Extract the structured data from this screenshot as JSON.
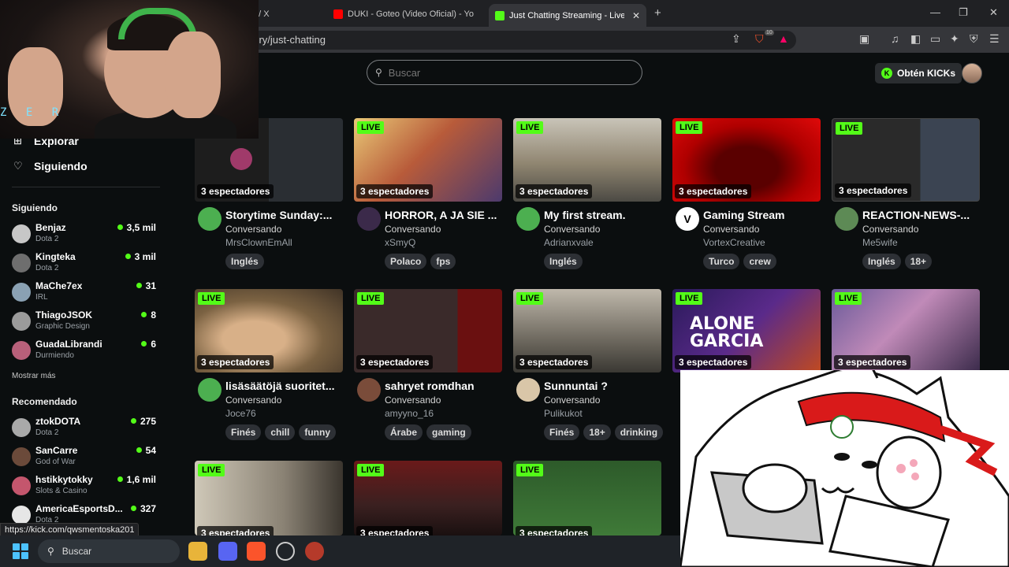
{
  "browser": {
    "tabs": [
      {
        "label": "OG / X"
      },
      {
        "label": "DUKI - Goteo (Video Oficial) - Yo"
      },
      {
        "label": "Just Chatting Streaming - Live St"
      }
    ],
    "url": "gory/just-chatting",
    "brave_badge": "10"
  },
  "header": {
    "search_placeholder": "Buscar",
    "kicks_label": "Obtén KICKs"
  },
  "sidebar": {
    "nav": [
      {
        "label": "Explorar"
      },
      {
        "label": "Siguiendo"
      }
    ],
    "following_title": "Siguiendo",
    "following": [
      {
        "name": "Benjaz",
        "category": "Dota 2",
        "viewers": "3,5 mil"
      },
      {
        "name": "Kingteka",
        "category": "Dota 2",
        "viewers": "3 mil"
      },
      {
        "name": "MaChe7ex",
        "category": "IRL",
        "viewers": "31"
      },
      {
        "name": "ThiagoJSOK",
        "category": "Graphic Design",
        "viewers": "8"
      },
      {
        "name": "GuadaLibrandi",
        "category": "Durmiendo",
        "viewers": "6"
      }
    ],
    "show_more": "Mostrar más",
    "recommended_title": "Recomendado",
    "recommended": [
      {
        "name": "ztokDOTA",
        "category": "Dota 2",
        "viewers": "275"
      },
      {
        "name": "SanCarre",
        "category": "God of War",
        "viewers": "54"
      },
      {
        "name": "hstikkytokky",
        "category": "Slots & Casino",
        "viewers": "1,6 mil"
      },
      {
        "name": "AmericaEsportsD...",
        "category": "Dota 2",
        "viewers": "327"
      }
    ]
  },
  "grid": {
    "live_label": "LIVE",
    "row1": [
      {
        "viewers": "3 espectadores",
        "title": "Storytime Sunday:...",
        "category": "Conversando",
        "user": "MrsClownEmAll",
        "tags": [
          "Inglés"
        ]
      },
      {
        "viewers": "3 espectadores",
        "title": "HORROR, A JA SIE ...",
        "category": "Conversando",
        "user": "xSmyQ",
        "tags": [
          "Polaco",
          "fps"
        ]
      },
      {
        "viewers": "3 espectadores",
        "title": "My first stream.",
        "category": "Conversando",
        "user": "Adrianxvale",
        "tags": [
          "Inglés"
        ]
      },
      {
        "viewers": "3 espectadores",
        "title": "Gaming Stream",
        "category": "Conversando",
        "user": "VortexCreative",
        "tags": [
          "Turco",
          "crew"
        ]
      },
      {
        "viewers": "3 espectadores",
        "title": "REACTION-NEWS-...",
        "category": "Conversando",
        "user": "Me5wife",
        "tags": [
          "Inglés",
          "18+"
        ]
      }
    ],
    "row2": [
      {
        "viewers": "3 espectadores",
        "title": "lisäsäätöjä suoritet...",
        "category": "Conversando",
        "user": "Joce76",
        "tags": [
          "Finés",
          "chill",
          "funny"
        ]
      },
      {
        "viewers": "3 espectadores",
        "title": "sahryet romdhan",
        "category": "Conversando",
        "user": "amyyno_16",
        "tags": [
          "Árabe",
          "gaming"
        ]
      },
      {
        "viewers": "3 espectadores",
        "title": "Sunnuntai ?",
        "category": "Conversando",
        "user": "Pulikukot",
        "tags": [
          "Finés",
          "18+",
          "drinking"
        ]
      },
      {
        "viewers": "3 espectadores",
        "thumb_text": "ALONE GARCIA"
      },
      {
        "viewers": "3 espectadores"
      }
    ],
    "row3": [
      {
        "viewers": "3 espectadores"
      },
      {
        "viewers": "3 espectadores"
      },
      {
        "viewers": "3 espectadores"
      }
    ]
  },
  "overlay": {
    "webcam_text": "Z E R"
  },
  "status_link": "https://kick.com/qwsmentoska201",
  "taskbar": {
    "search_label": "Buscar"
  },
  "colors": {
    "accent": "#53fc18",
    "background": "#0b0e0f"
  }
}
